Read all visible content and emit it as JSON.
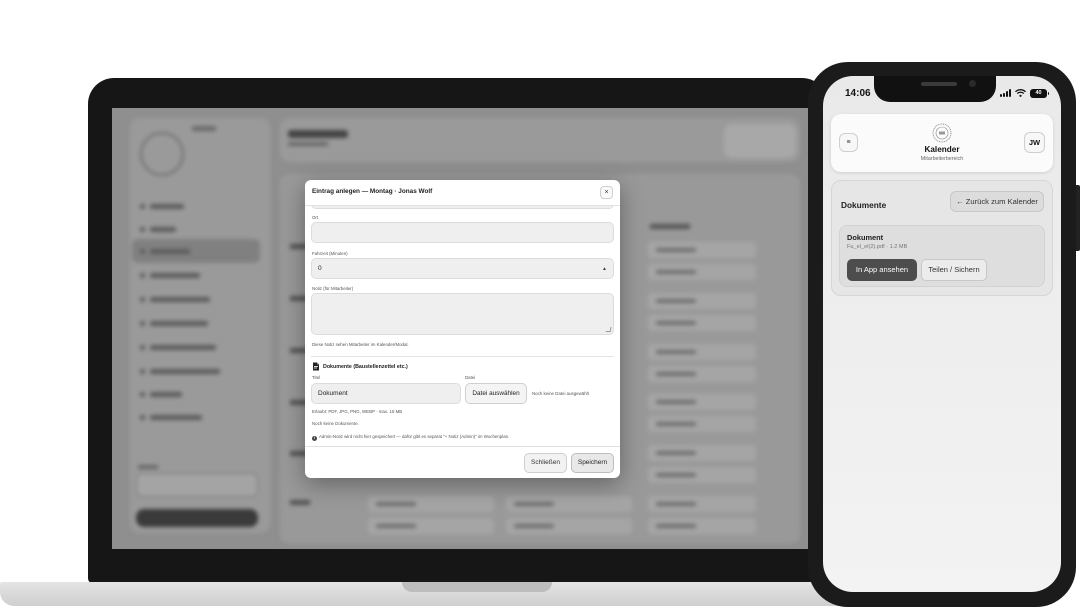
{
  "modal": {
    "title": "Eintrag anlegen — Montag · Jonas Wolf",
    "close_icon": "×",
    "ort_label": "Ort",
    "ort_value": "",
    "fahrzeit_label": "Fahrzeit (Minuten)",
    "fahrzeit_value": "0",
    "notiz_label": "Notiz (für Mitarbeiter)",
    "notiz_value": "",
    "notiz_hint": "Diese Notiz sehen Mitarbeiter im Kalender/Modal.",
    "documents_title": "Dokumente (Baustellenzettel etc.)",
    "titel_label": "Titel",
    "titel_value": "Dokument",
    "datei_label": "Datei",
    "file_button": "Datei auswählen",
    "file_status": "Noch keine Datei ausgewählt",
    "allowed_types": "Erlaubt: PDF, JPG, PNG, WEBP · max. 15 MB",
    "no_documents": "Noch keine Dokumente.",
    "admin_note": "Admin-Notiz wird nicht hier gespeichert — dafür gibt es separat \"+ Notiz (Admin)\" im Wochenplan.",
    "cancel_button": "Schließen",
    "save_button": "Speichern"
  },
  "phone": {
    "time": "14:06",
    "battery": "40",
    "menu_icon": "≡",
    "app_title": "Kalender",
    "app_subtitle": "Mitarbeiterbereich",
    "avatar_initials": "JW",
    "section_title": "Dokumente",
    "back_button": "← Zurück zum Kalender",
    "document": {
      "title": "Dokument",
      "meta": "Fu_el_el(2).pdf · 1.2 MB",
      "view_button": "In App ansehen",
      "share_button": "Teilen / Sichern"
    }
  },
  "icons": {
    "document_section": "document-icon",
    "info": "info-icon",
    "select_chevron": "chevron-updown-icon",
    "signal": "signal-icon",
    "wifi": "wifi-icon",
    "battery": "battery-icon",
    "logo": "seal-logo-icon"
  },
  "colors": {
    "primary_button": "#4d4d4d",
    "overlay": "#8f8f8f"
  }
}
